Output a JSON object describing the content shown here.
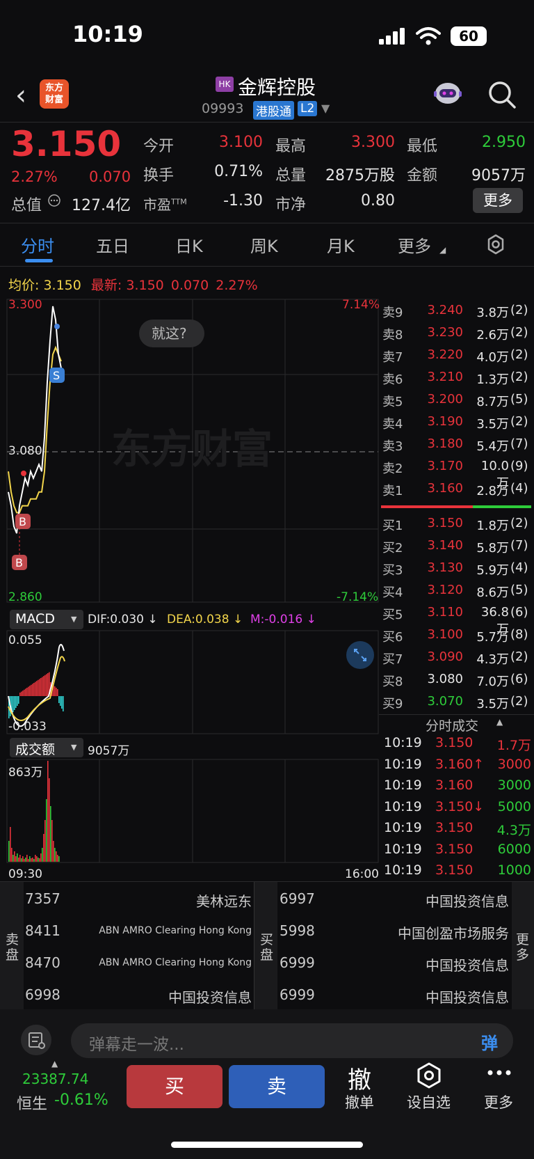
{
  "status": {
    "time": "10:19",
    "battery": "60"
  },
  "header": {
    "logo_text": "东方财富",
    "market_tag": "HK",
    "stock_name": "金辉控股",
    "stock_code": "09993",
    "badge_connect": "港股通",
    "badge_level": "L2"
  },
  "quote": {
    "price": "3.150",
    "change_pct": "2.27%",
    "change": "0.070",
    "open_label": "今开",
    "open": "3.100",
    "high_label": "最高",
    "high": "3.300",
    "low_label": "最低",
    "low": "2.950",
    "turnover_label": "换手",
    "turnover": "0.71%",
    "volume_label": "总量",
    "volume": "2875万股",
    "amount_label": "金额",
    "amount": "9057万",
    "mktcap_label": "总值",
    "mktcap": "127.4亿",
    "pe_label": "市盈",
    "pe_sup": "TTM",
    "pe": "-1.30",
    "pb_label": "市净",
    "pb": "0.80",
    "more_label": "更多"
  },
  "tabs": [
    "分时",
    "五日",
    "日K",
    "周K",
    "月K",
    "更多"
  ],
  "chart_info": {
    "avg_label": "均价:",
    "avg": "3.150",
    "last_label": "最新:",
    "last": "3.150",
    "chg": "0.070",
    "pct": "2.27%"
  },
  "chart_data": {
    "type": "line",
    "y_top": "3.300",
    "y_mid": "3.080",
    "y_bottom": "2.860",
    "pct_top": "7.14%",
    "pct_bottom": "-7.14%",
    "x_start": "09:30",
    "x_end": "16:00",
    "tooltip": "就这?",
    "watermark": "东方财富",
    "markers": [
      "S",
      "B",
      "B"
    ],
    "ylim": [
      2.86,
      3.3
    ],
    "series": [
      {
        "values": [
          3.02,
          3.0,
          2.97,
          2.96,
          3.0,
          3.02,
          3.04,
          3.03,
          3.05,
          3.04,
          3.05,
          3.06,
          3.05,
          3.1,
          3.18,
          3.24,
          3.29,
          3.27,
          3.22,
          3.2
        ]
      },
      {
        "values": [
          3.05,
          3.02,
          3.0,
          2.99,
          2.99,
          3.0,
          3.0,
          3.0,
          3.01,
          3.01,
          3.01,
          3.02,
          3.02,
          3.05,
          3.12,
          3.18,
          3.22,
          3.23,
          3.22,
          3.21
        ]
      }
    ]
  },
  "macd": {
    "label": "MACD",
    "dif": "DIF:0.030 ↓",
    "dea": "DEA:0.038 ↓",
    "m": "M:-0.016 ↓",
    "top": "0.055",
    "bottom": "-0.033"
  },
  "volume_panel": {
    "label": "成交额",
    "total": "9057万",
    "max": "863万"
  },
  "orderbook": {
    "asks": [
      {
        "label": "卖9",
        "price": "3.240",
        "qty": "3.8万",
        "cnt": "(2)"
      },
      {
        "label": "卖8",
        "price": "3.230",
        "qty": "2.6万",
        "cnt": "(2)"
      },
      {
        "label": "卖7",
        "price": "3.220",
        "qty": "4.0万",
        "cnt": "(2)"
      },
      {
        "label": "卖6",
        "price": "3.210",
        "qty": "1.3万",
        "cnt": "(2)"
      },
      {
        "label": "卖5",
        "price": "3.200",
        "qty": "8.7万",
        "cnt": "(5)"
      },
      {
        "label": "卖4",
        "price": "3.190",
        "qty": "3.5万",
        "cnt": "(2)"
      },
      {
        "label": "卖3",
        "price": "3.180",
        "qty": "5.4万",
        "cnt": "(7)"
      },
      {
        "label": "卖2",
        "price": "3.170",
        "qty": "10.0万",
        "cnt": "(9)"
      },
      {
        "label": "卖1",
        "price": "3.160",
        "qty": "2.8万",
        "cnt": "(4)"
      }
    ],
    "bids": [
      {
        "label": "买1",
        "price": "3.150",
        "qty": "1.8万",
        "cnt": "(2)"
      },
      {
        "label": "买2",
        "price": "3.140",
        "qty": "5.8万",
        "cnt": "(7)"
      },
      {
        "label": "买3",
        "price": "3.130",
        "qty": "5.9万",
        "cnt": "(4)"
      },
      {
        "label": "买4",
        "price": "3.120",
        "qty": "8.6万",
        "cnt": "(5)"
      },
      {
        "label": "买5",
        "price": "3.110",
        "qty": "36.8万",
        "cnt": "(6)"
      },
      {
        "label": "买6",
        "price": "3.100",
        "qty": "5.7万",
        "cnt": "(8)"
      },
      {
        "label": "买7",
        "price": "3.090",
        "qty": "4.3万",
        "cnt": "(2)"
      },
      {
        "label": "买8",
        "price": "3.080",
        "qty": "7.0万",
        "cnt": "(6)"
      },
      {
        "label": "买9",
        "price": "3.070",
        "qty": "3.5万",
        "cnt": "(2)"
      }
    ]
  },
  "ticks": {
    "title": "分时成交",
    "rows": [
      {
        "time": "10:19",
        "price": "3.150",
        "vol": "1.7万"
      },
      {
        "time": "10:19",
        "price": "3.160↑",
        "vol": "3000"
      },
      {
        "time": "10:19",
        "price": "3.160",
        "vol": "3000"
      },
      {
        "time": "10:19",
        "price": "3.150↓",
        "vol": "5000"
      },
      {
        "time": "10:19",
        "price": "3.150",
        "vol": "4.3万"
      },
      {
        "time": "10:19",
        "price": "3.150",
        "vol": "6000"
      },
      {
        "time": "10:19",
        "price": "3.150",
        "vol": "1000"
      }
    ]
  },
  "brokers": {
    "sell_label": "卖盘",
    "buy_label": "买盘",
    "more_label": "更多",
    "sell": [
      {
        "id": "7357",
        "name": "美林远东"
      },
      {
        "id": "8411",
        "name": "ABN AMRO Clearing Hong Kong"
      },
      {
        "id": "8470",
        "name": "ABN AMRO Clearing Hong Kong"
      },
      {
        "id": "6998",
        "name": "中国投资信息"
      }
    ],
    "buy": [
      {
        "id": "6997",
        "name": "中国投资信息"
      },
      {
        "id": "5998",
        "name": "中国创盈市场服务"
      },
      {
        "id": "6999",
        "name": "中国投资信息"
      },
      {
        "id": "6999",
        "name": "中国投资信息"
      }
    ]
  },
  "danmu": {
    "placeholder": "弹幕走一波...",
    "btn": "弹"
  },
  "bottom": {
    "index_value": "23387.74",
    "index_name": "恒生",
    "index_chg": "-0.61%",
    "buy": "买",
    "sell": "卖",
    "cancel_icon": "撤",
    "cancel": "撤单",
    "watch": "设自选",
    "more": "更多"
  }
}
